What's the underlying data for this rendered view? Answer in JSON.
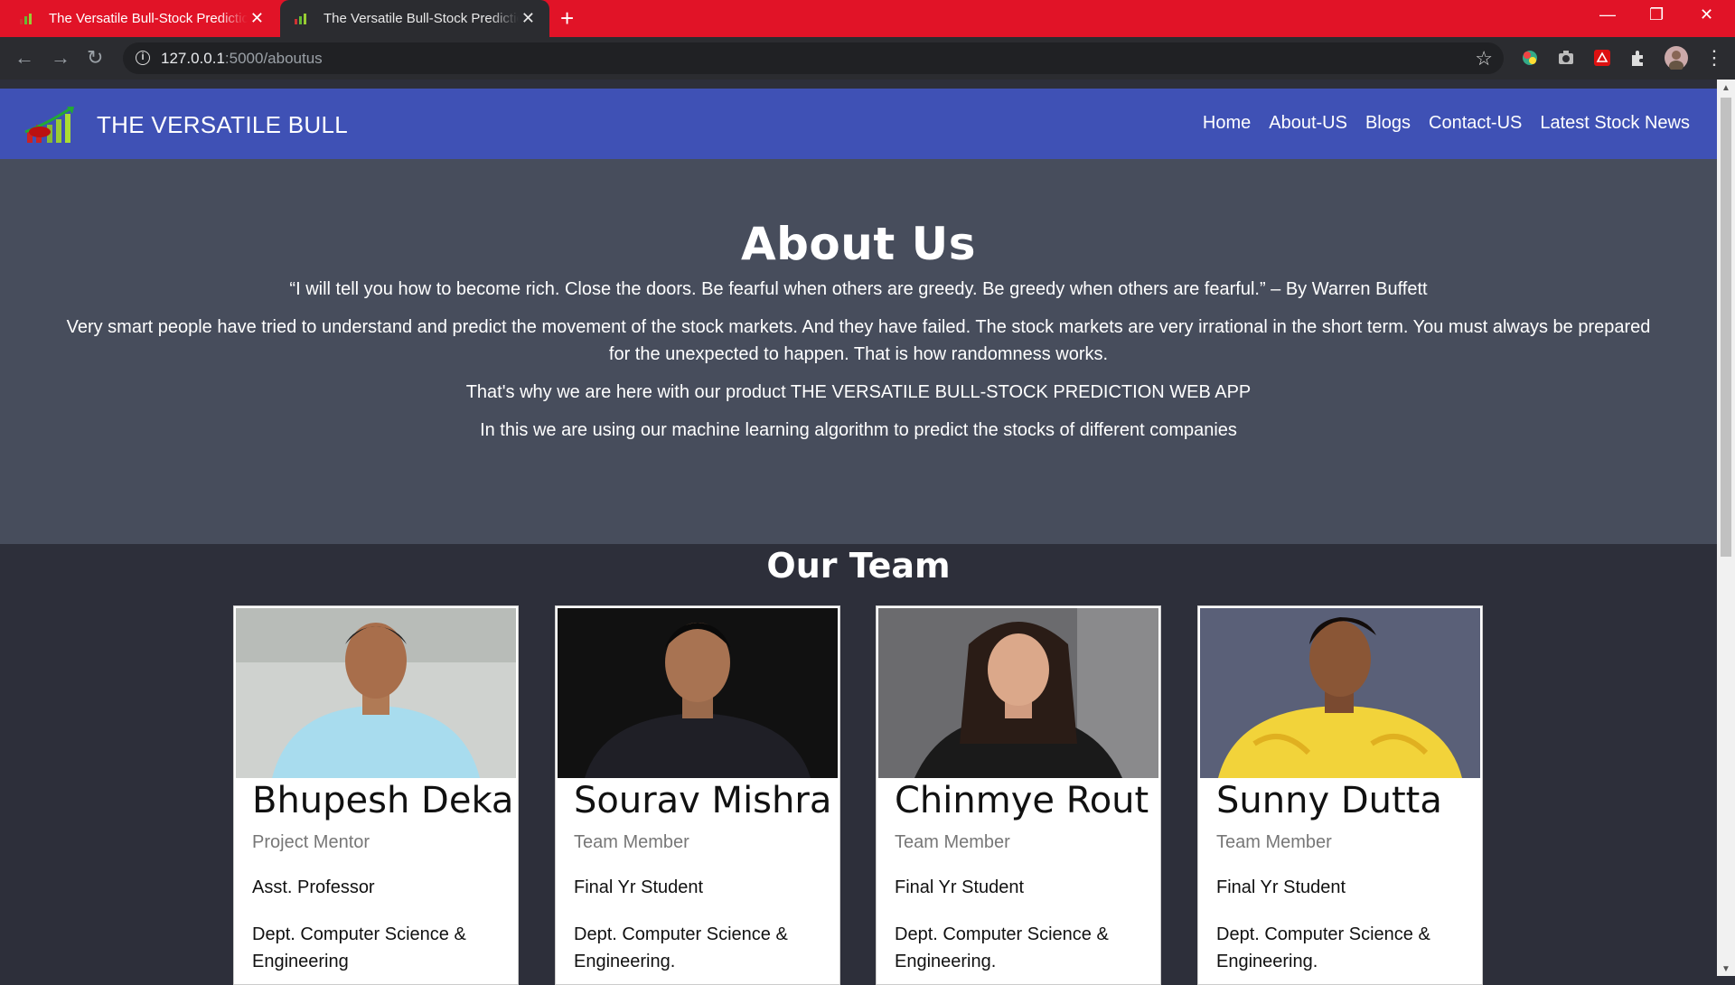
{
  "browser": {
    "tabs": [
      {
        "title": "The Versatile Bull-Stock Prediction"
      },
      {
        "title": "The Versatile Bull-Stock Prediction"
      }
    ],
    "new_tab_label": "+",
    "address": {
      "host": "127.0.0.1",
      "path": ":5000/aboutus"
    }
  },
  "site": {
    "brand": "THE VERSATILE BULL",
    "nav": [
      "Home",
      "About-US",
      "Blogs",
      "Contact-US",
      "Latest Stock News"
    ]
  },
  "about": {
    "heading": "About Us",
    "quote": "“I will tell you how to become rich. Close the doors. Be fearful when others are greedy. Be greedy when others are fearful.” – By Warren Buffett",
    "para1": "Very smart people have tried to understand and predict the movement of the stock markets. And they have failed. The stock markets are very irrational in the short term. You must always be prepared for the unexpected to happen. That is how randomness works.",
    "para2": "That's why we are here with our product THE VERSATILE BULL-STOCK PREDICTION WEB APP",
    "para3": "In this we are using our machine learning algorithm to predict the stocks of different companies"
  },
  "team": {
    "heading": "Our Team",
    "members": [
      {
        "name": "Bhupesh Deka",
        "role": "Project Mentor",
        "position": "Asst. Professor",
        "dept": "Dept. Computer Science & Engineering"
      },
      {
        "name": "Sourav Mishra",
        "role": "Team Member",
        "position": "Final Yr Student",
        "dept": "Dept. Computer Science & Engineering."
      },
      {
        "name": "Chinmye Rout",
        "role": "Team Member",
        "position": "Final Yr Student",
        "dept": "Dept. Computer Science & Engineering."
      },
      {
        "name": "Sunny Dutta",
        "role": "Team Member",
        "position": "Final Yr Student",
        "dept": "Dept. Computer Science & Engineering."
      }
    ]
  },
  "colors": {
    "tabbar": "#e11327",
    "navbar": "#3f51b5",
    "about_bg": "#474d5c",
    "team_bg": "#2d2f3a"
  }
}
